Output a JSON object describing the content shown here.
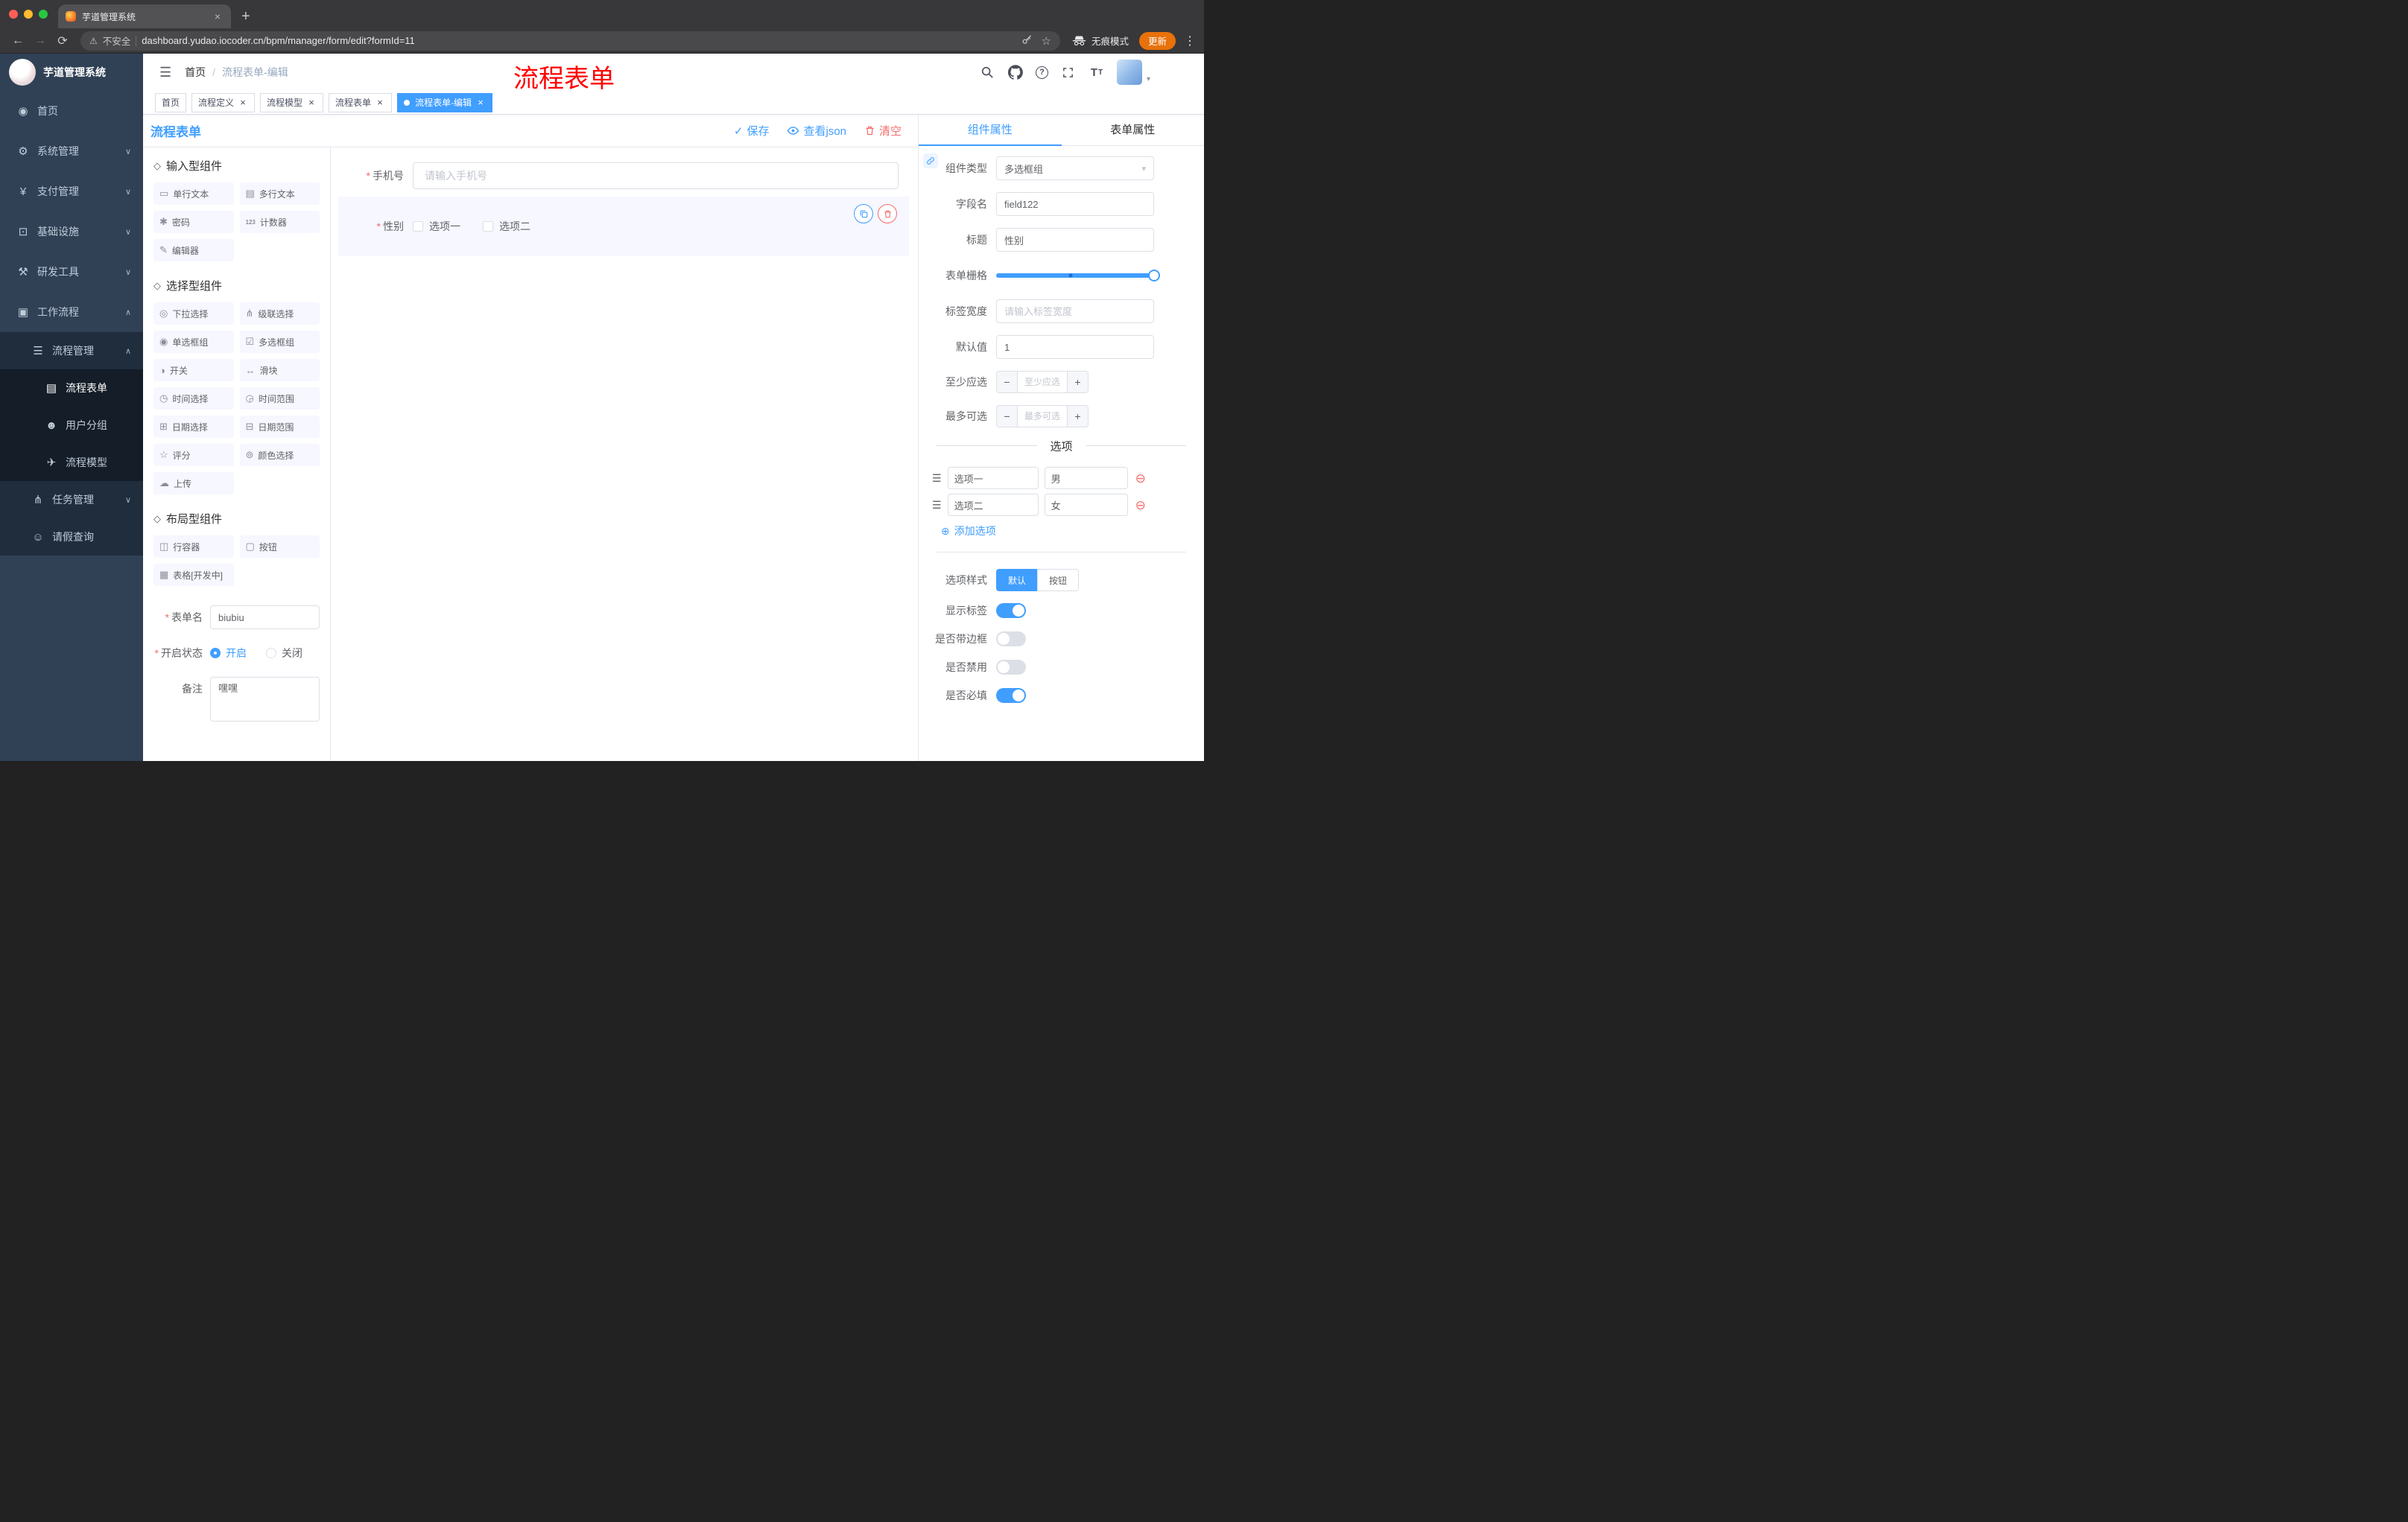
{
  "browser": {
    "tab_title": "芋道管理系统",
    "security": "不安全",
    "url": "dashboard.yudao.iocoder.cn/bpm/manager/form/edit?formId=11",
    "incognito": "无痕模式",
    "update": "更新"
  },
  "colors": {
    "accent": "#409eff",
    "danger": "#f56c6c",
    "sidebar_bg": "#304156",
    "annotation": "#ff0000",
    "update_button": "#e8710a",
    "selected_field_bg": "#f6f7ff"
  },
  "icons": {
    "hamburger": "☰",
    "back": "←",
    "forward": "→",
    "reload": "⟳",
    "warning": "⚠",
    "star": "☆",
    "dots": "⋮",
    "plus": "+",
    "close": "×",
    "caret_down": "▾",
    "chevron_down": "∨",
    "chevron_up": "∧",
    "slash": "/",
    "asterisk": "*",
    "question": "?",
    "check": "✓",
    "font_size": "T",
    "dashboard": "◉",
    "gear": "⚙",
    "yen": "¥",
    "monitor": "⊡",
    "tools": "⚒",
    "briefcase": "▣",
    "list": "☰",
    "document": "▤",
    "users": "☻",
    "send": "✈",
    "tree": "⋔",
    "person": "☺",
    "component_group": "◇",
    "input_single": "▭",
    "input_multi": "▤",
    "password": "✱",
    "counter": "123",
    "editor": "✎",
    "select": "◎",
    "cascader": "⋔",
    "radio": "◉",
    "checkbox": "☑",
    "switch": "◑",
    "slider": "↔",
    "time": "◷",
    "time_range": "◶",
    "date": "⊞",
    "date_range": "⊟",
    "rate": "☆",
    "color": "⊚",
    "upload": "☁",
    "row_container": "◫",
    "button": "▢",
    "table": "▦",
    "add_circle": "⊕",
    "remove_circle": "⊖",
    "drag": "☰",
    "minus": "−"
  },
  "sidebar": {
    "app_title": "芋道管理系统",
    "items": [
      {
        "label": "首页"
      },
      {
        "label": "系统管理"
      },
      {
        "label": "支付管理"
      },
      {
        "label": "基础设施"
      },
      {
        "label": "研发工具"
      },
      {
        "label": "工作流程"
      },
      {
        "label": "流程管理"
      },
      {
        "label": "流程表单"
      },
      {
        "label": "用户分组"
      },
      {
        "label": "流程模型"
      },
      {
        "label": "任务管理"
      },
      {
        "label": "请假查询"
      }
    ]
  },
  "header": {
    "breadcrumb_home": "首页",
    "breadcrumb_current": "流程表单-编辑",
    "annotation": "流程表单"
  },
  "tags": [
    {
      "label": "首页"
    },
    {
      "label": "流程定义"
    },
    {
      "label": "流程模型"
    },
    {
      "label": "流程表单"
    },
    {
      "label": "流程表单-编辑"
    }
  ],
  "designer": {
    "title": "流程表单",
    "actions": {
      "save": "保存",
      "view_json": "查看json",
      "clear": "清空"
    },
    "palette": {
      "groups": [
        {
          "title": "输入型组件",
          "items": [
            "单行文本",
            "多行文本",
            "密码",
            "计数器",
            "编辑器"
          ]
        },
        {
          "title": "选择型组件",
          "items": [
            "下拉选择",
            "级联选择",
            "单选框组",
            "多选框组",
            "开关",
            "滑块",
            "时间选择",
            "时间范围",
            "日期选择",
            "日期范围",
            "评分",
            "颜色选择",
            "上传"
          ]
        },
        {
          "title": "布局型组件",
          "items": [
            "行容器",
            "按钮",
            "表格[开发中]"
          ]
        }
      ]
    },
    "meta": {
      "name_label": "表单名",
      "name_value": "biubiu",
      "status_label": "开启状态",
      "status_on": "开启",
      "status_off": "关闭",
      "status_selected": "开启",
      "remark_label": "备注",
      "remark_value": "嘿嘿"
    },
    "canvas": {
      "phone": {
        "label": "手机号",
        "placeholder": "请输入手机号",
        "required": true
      },
      "gender": {
        "label": "性别",
        "options": [
          "选项一",
          "选项二"
        ],
        "required": true,
        "selected": true
      }
    }
  },
  "properties": {
    "tabs": {
      "component": "组件属性",
      "form": "表单属性"
    },
    "active_tab": "组件属性",
    "rows": {
      "type_label": "组件类型",
      "type_value": "多选框组",
      "field_label": "字段名",
      "field_value": "field122",
      "title_label": "标题",
      "title_value": "性别",
      "grid_label": "表单栅格",
      "width_label": "标签宽度",
      "width_placeholder": "请输入标签宽度",
      "default_label": "默认值",
      "default_value": "1",
      "min_label": "至少应选",
      "min_placeholder": "至少应选",
      "max_label": "最多可选",
      "max_placeholder": "最多可选"
    },
    "options_title": "选项",
    "options": [
      {
        "label": "选项一",
        "value": "男"
      },
      {
        "label": "选项二",
        "value": "女"
      }
    ],
    "add_option": "添加选项",
    "style_label": "选项样式",
    "style_default": "默认",
    "style_button": "按钮",
    "style_selected": "默认",
    "toggles": [
      {
        "label": "显示标签",
        "on": true
      },
      {
        "label": "是否带边框",
        "on": false
      },
      {
        "label": "是否禁用",
        "on": false
      },
      {
        "label": "是否必填",
        "on": true
      }
    ]
  }
}
